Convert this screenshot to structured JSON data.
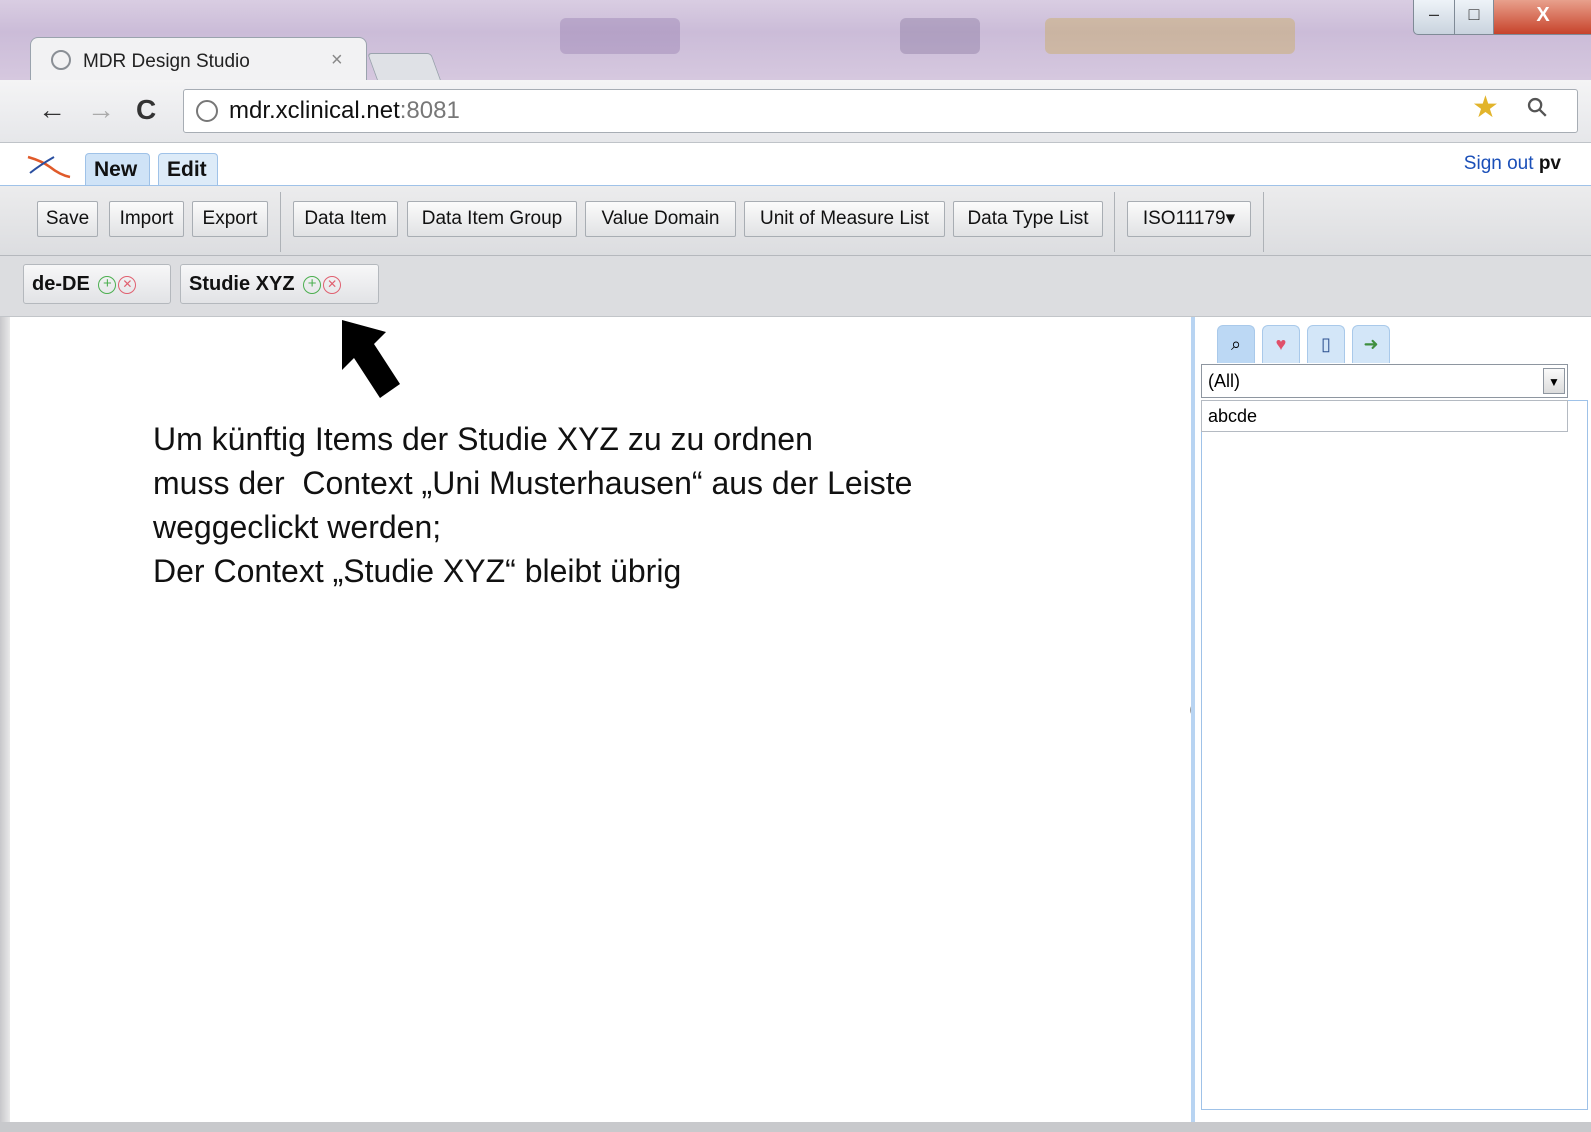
{
  "browser": {
    "tab_title": "MDR Design Studio",
    "tab_close": "×",
    "address_host": "mdr.xclinical.net",
    "address_port": ":8081",
    "nav": {
      "back": "←",
      "forward": "→",
      "reload": "C"
    },
    "window_controls": {
      "minimize": "–",
      "maximize": "□",
      "close": "X"
    }
  },
  "app": {
    "tabs": [
      {
        "label": "New"
      },
      {
        "label": "Edit"
      }
    ],
    "signout": {
      "link": "Sign out",
      "user": "pv"
    },
    "ribbon": {
      "save": "Save",
      "import": "Import",
      "export": "Export",
      "data_item": "Data Item",
      "data_item_group": "Data Item Group",
      "value_domain": "Value Domain",
      "unit_of_measure_list": "Unit of Measure List",
      "data_type_list": "Data Type List",
      "iso": "ISO11179▾"
    },
    "contexts": [
      {
        "label": "de-DE"
      },
      {
        "label": "Studie XYZ"
      }
    ]
  },
  "annotation": {
    "line1": "Um künftig Items der Studie XYZ zu zu ordnen",
    "line2": "muss der  Context „Uni Musterhausen“ aus der Leiste",
    "line3": "weggeclickt werden;",
    "line4": "Der Context „Studie XYZ“ bleibt übrig"
  },
  "right_panel": {
    "select_value": "(All)",
    "filter_value": "abcde",
    "tab_icons": [
      "binoculars-icon",
      "heart-icon",
      "book-icon",
      "export-icon"
    ]
  },
  "colors": {
    "accent": "#9fc2e8",
    "link": "#1a4fb8",
    "tab_active": "#cfe3f7"
  }
}
